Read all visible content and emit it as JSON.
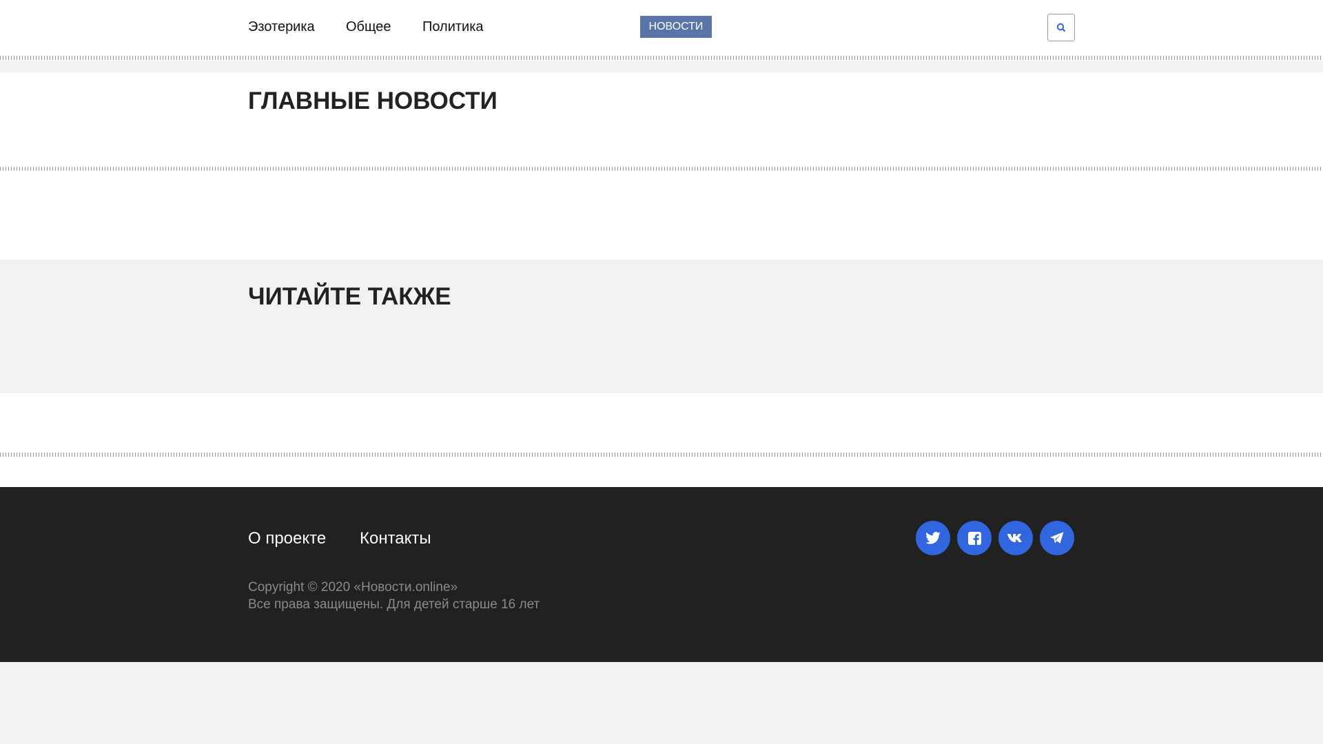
{
  "header": {
    "nav": [
      "Эзотерика",
      "Общее",
      "Политика"
    ],
    "logo_button": "НОВОСТИ",
    "search_icon": "search-icon"
  },
  "main": {
    "top_news_title": "ГЛАВНЫЕ НОВОСТИ",
    "read_also_title": "ЧИТАЙТЕ ТАКЖЕ"
  },
  "footer": {
    "links": [
      "О проекте",
      "Контакты"
    ],
    "social": [
      "twitter-icon",
      "facebook-icon",
      "vk-icon",
      "telegram-icon"
    ],
    "copyright": "Copyright © 2020 «Новости.online»",
    "rights": "Все права защищены. Для детей старше 16 лет"
  },
  "colors": {
    "accent": "#3166df",
    "logo_bg": "#5874a8",
    "footer_bg": "#212121"
  }
}
